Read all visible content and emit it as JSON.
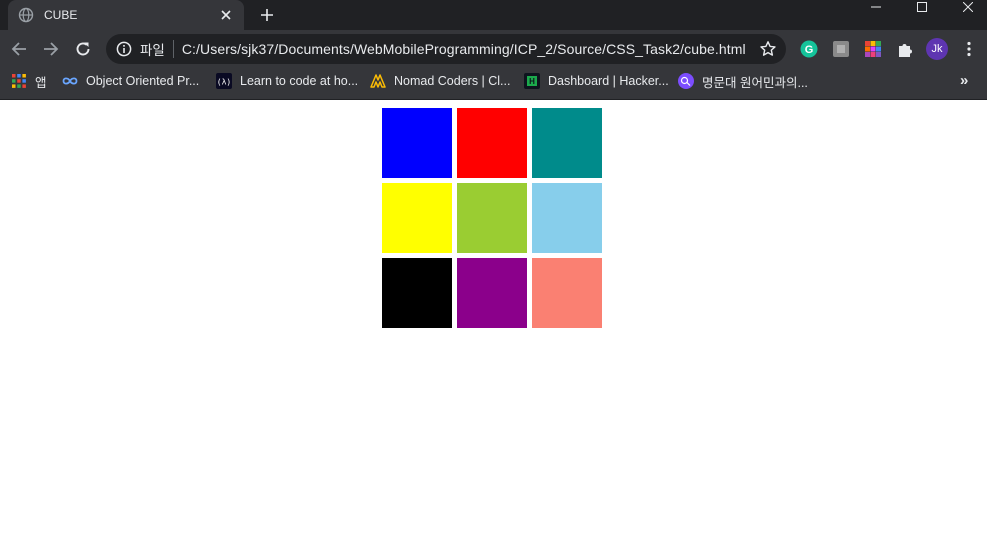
{
  "browser": {
    "tab": {
      "title": "CUBE",
      "favicon": "globe-icon"
    },
    "omnibox": {
      "scheme_label": "파일",
      "url": "C:/Users/sjk37/Documents/WebMobileProgramming/ICP_2/Source/CSS_Task2/cube.html"
    },
    "profile_initials": "Jk",
    "bookmarks": [
      {
        "label": "앱",
        "icon": "apps-grid-icon"
      },
      {
        "label": "Object Oriented Pr...",
        "icon": "infinity-icon"
      },
      {
        "label": "Learn to code at ho...",
        "icon": "freecodecamp-icon"
      },
      {
        "label": "Nomad Coders | Cl...",
        "icon": "nomad-coders-icon"
      },
      {
        "label": "Dashboard | Hacker...",
        "icon": "hackerrank-icon"
      },
      {
        "label": "명문대 원어민과의...",
        "icon": "chat-bubble-icon"
      }
    ],
    "bookmarks_overflow": "»"
  },
  "page": {
    "cells": [
      {
        "color": "#0000ff"
      },
      {
        "color": "#ff0000"
      },
      {
        "color": "#008b8b"
      },
      {
        "color": "#ffff00"
      },
      {
        "color": "#9acd32"
      },
      {
        "color": "#87ceeb"
      },
      {
        "color": "#000000"
      },
      {
        "color": "#8b008b"
      },
      {
        "color": "#fa8072"
      }
    ]
  }
}
